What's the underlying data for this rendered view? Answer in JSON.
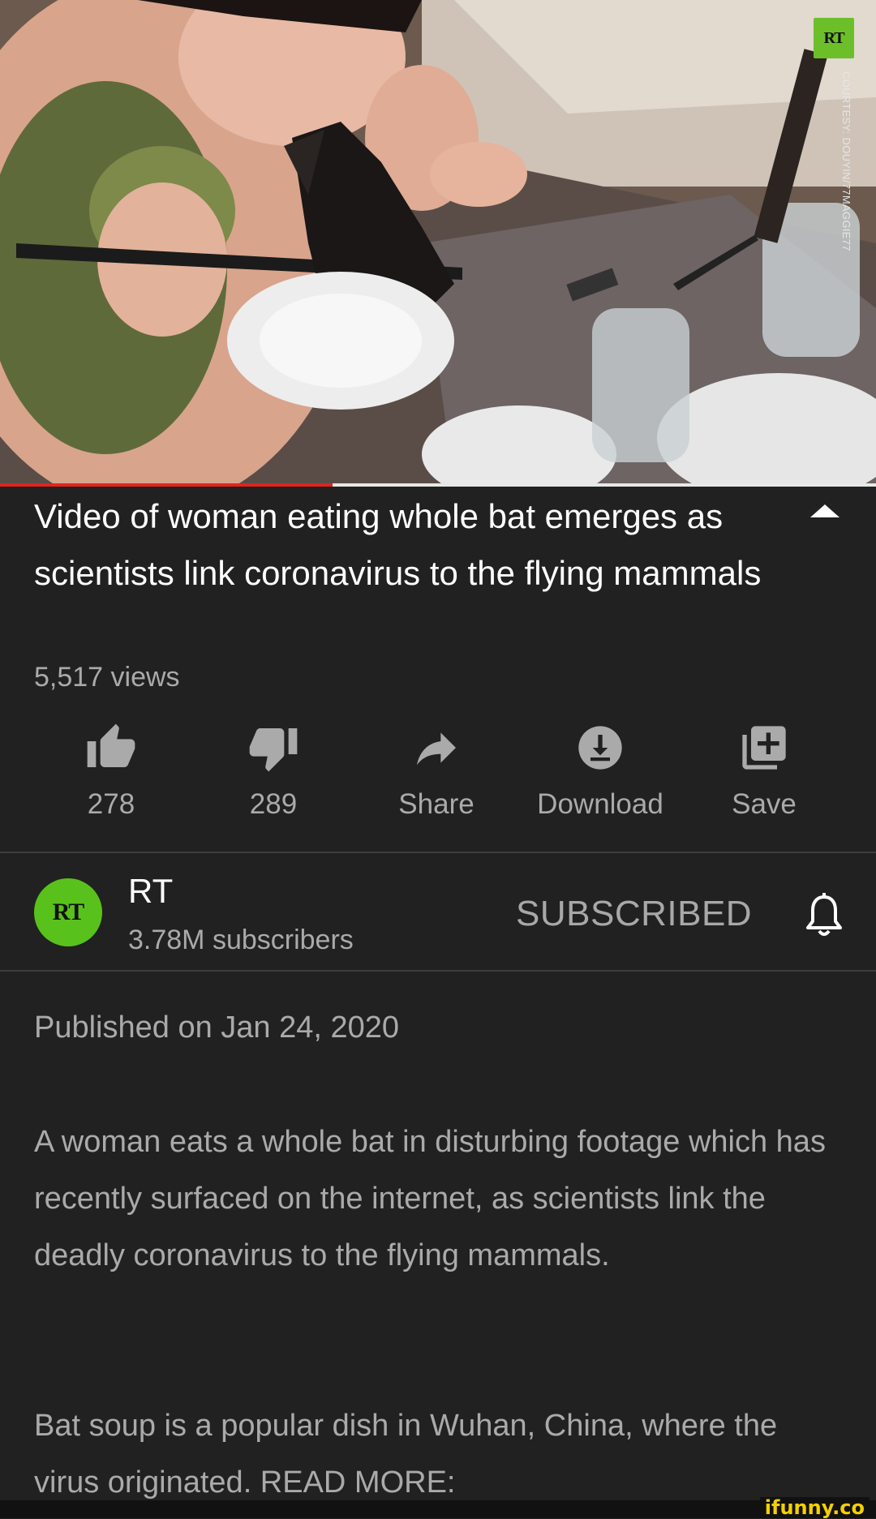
{
  "video": {
    "channel_logo_text": "RT",
    "courtesy_text": "COURTESY: DOUYIN/77MAGGIE77",
    "progress_fraction": 0.38
  },
  "title": "Video of woman eating whole bat emerges as scientists link coronavirus to the flying mammals",
  "views": "5,517 views",
  "actions": [
    {
      "name": "like",
      "icon": "thumbs-up-icon",
      "label": "278"
    },
    {
      "name": "dislike",
      "icon": "thumbs-down-icon",
      "label": "289"
    },
    {
      "name": "share",
      "icon": "share-arrow-icon",
      "label": "Share"
    },
    {
      "name": "download",
      "icon": "download-icon",
      "label": "Download"
    },
    {
      "name": "save",
      "icon": "add-to-playlist-icon",
      "label": "Save"
    }
  ],
  "channel": {
    "avatar_text": "RT",
    "name": "RT",
    "subscribers": "3.78M subscribers",
    "subscribe_label": "SUBSCRIBED",
    "bell_icon": "bell-icon"
  },
  "description": {
    "published": "Published on Jan 24, 2020",
    "paragraph1": "A woman eats a whole bat in disturbing footage which has recently surfaced on the internet, as scientists link the deadly coronavirus to the flying mammals.",
    "paragraph2": "Bat soup is a popular dish in Wuhan, China, where the virus originated. READ MORE:"
  },
  "watermark": "ifunny.co",
  "colors": {
    "background": "#212121",
    "progress": "#e3241b",
    "rt_green": "#59c11c",
    "secondary_text": "#aaaaaa",
    "watermark": "#f5d000"
  }
}
